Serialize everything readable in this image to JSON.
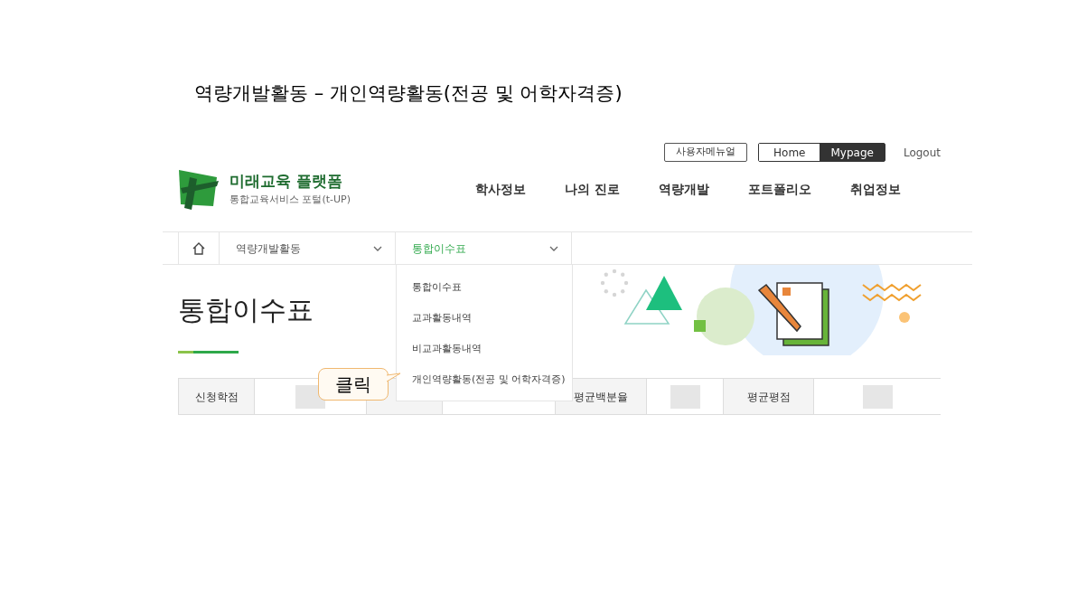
{
  "caption": "역량개발활동 – 개인역량활동(전공 및 어학자격증)",
  "utility": {
    "manual": "사용자메뉴얼",
    "toggle": [
      {
        "label": "Home",
        "selected": false
      },
      {
        "label": "Mypage",
        "selected": true
      }
    ],
    "logout": "Logout"
  },
  "logo": {
    "title": "미래교육 플랫폼",
    "subtitle": "통합교육서비스 포털(t-UP)"
  },
  "nav": [
    "학사정보",
    "나의 진로",
    "역량개발",
    "포트폴리오",
    "취업정보"
  ],
  "breadcrumb": [
    {
      "label": "역량개발활동",
      "current": false
    },
    {
      "label": "통합이수표",
      "current": true
    }
  ],
  "dropdown": [
    "통합이수표",
    "교과활동내역",
    "비교과활동내역",
    "개인역량활동(전공 및 어학자격증)"
  ],
  "page_title": "통합이수표",
  "summary_table": [
    {
      "header": "신청학점",
      "masked": true
    },
    {
      "masked": false
    },
    {
      "header": "평균백분율",
      "masked": true
    },
    {
      "header": "평균평점",
      "masked": true
    }
  ],
  "callout": "클릭"
}
